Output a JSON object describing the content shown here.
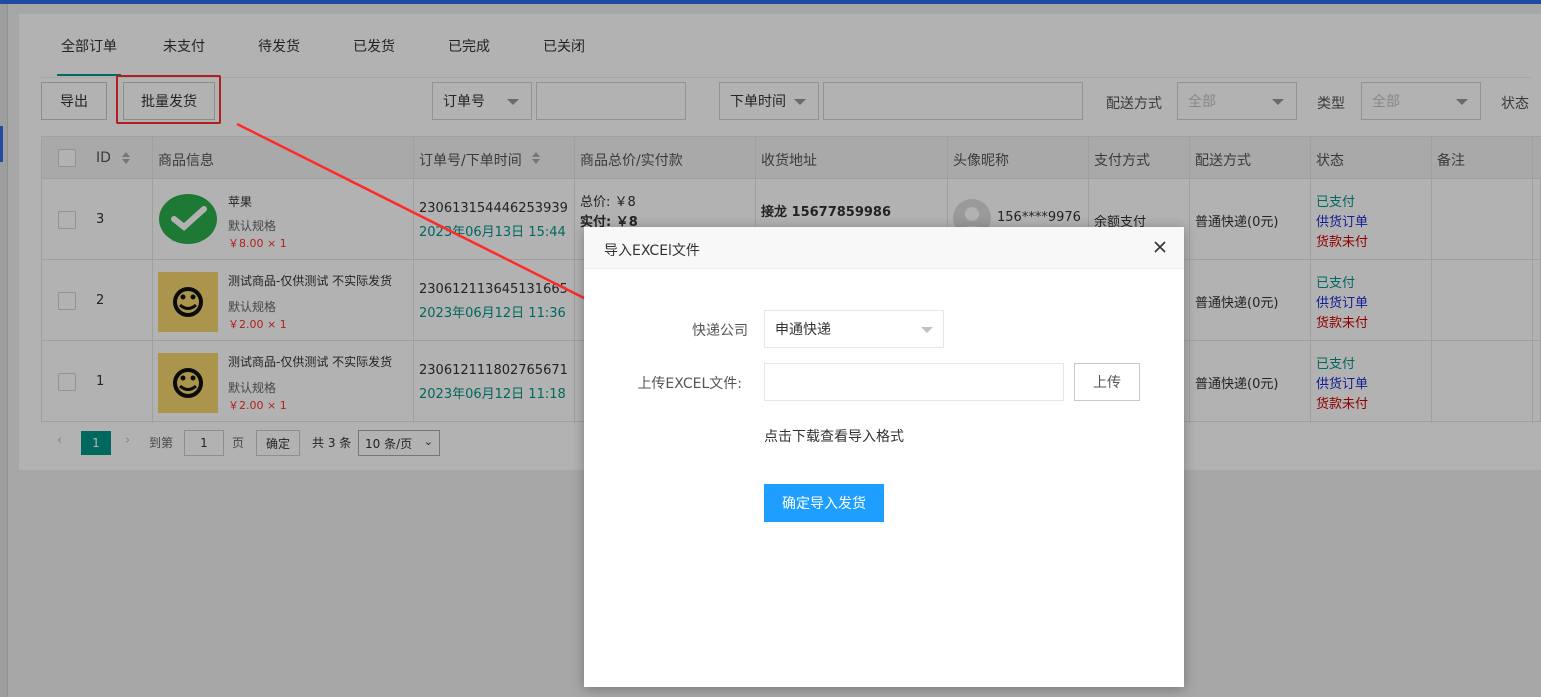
{
  "tabs": [
    "全部订单",
    "未支付",
    "待发货",
    "已发货",
    "已完成",
    "已关闭"
  ],
  "toolbar": {
    "export_label": "导出",
    "batch_ship_label": "批量发货"
  },
  "filters": {
    "order_field": "订单号",
    "time_field": "下单时间",
    "delivery_label": "配送方式",
    "delivery_value": "全部",
    "type_label": "类型",
    "type_value": "全部",
    "status_label": "状态"
  },
  "table": {
    "headers": [
      "ID",
      "商品信息",
      "订单号/下单时间",
      "商品总价/实付款",
      "收货地址",
      "头像昵称",
      "支付方式",
      "配送方式",
      "状态",
      "备注"
    ],
    "rows": [
      {
        "id": "3",
        "product": "苹果",
        "spec": "默认规格",
        "price": "￥8.00 × 1",
        "order_no": "230613154446253939",
        "time": "2023年06月13日 15:44",
        "total": "总价: ￥8",
        "paid": "实付: ￥8",
        "address": "接龙 15677859986",
        "nickname": "156****9976",
        "pay": "余额支付",
        "delivery": "普通快递(0元)",
        "s1": "已支付",
        "s2": "供货订单",
        "s3": "货款未付"
      },
      {
        "id": "2",
        "product": "测试商品-仅供测试 不实际发货",
        "spec": "默认规格",
        "price": "￥2.00 × 1",
        "order_no": "230612113645131665",
        "time": "2023年06月12日 11:36",
        "total": "",
        "paid": "",
        "address": "",
        "nickname": "",
        "pay": "",
        "delivery": "普通快递(0元)",
        "s1": "已支付",
        "s2": "供货订单",
        "s3": "货款未付"
      },
      {
        "id": "1",
        "product": "测试商品-仅供测试 不实际发货",
        "spec": "默认规格",
        "price": "￥2.00 × 1",
        "order_no": "230612111802765671",
        "time": "2023年06月12日 11:18",
        "total": "",
        "paid": "",
        "address": "",
        "nickname": "",
        "pay": "",
        "delivery": "普通快递(0元)",
        "s1": "已支付",
        "s2": "供货订单",
        "s3": "货款未付"
      }
    ]
  },
  "pager": {
    "current": "1",
    "goto_label": "到第",
    "page_value": "1",
    "page_unit": "页",
    "confirm": "确定",
    "total": "共 3 条",
    "page_size": "10 条/页"
  },
  "modal": {
    "title": "导入EXCEl文件",
    "courier_label": "快递公司",
    "courier_value": "申通快递",
    "upload_label": "上传EXCEL文件:",
    "upload_button": "上传",
    "download_link": "点击下载查看导入格式",
    "submit": "确定导入发货"
  },
  "colors": {
    "accent": "#009688",
    "primary": "#1e9fff",
    "highlight": "#ff2a2a"
  }
}
